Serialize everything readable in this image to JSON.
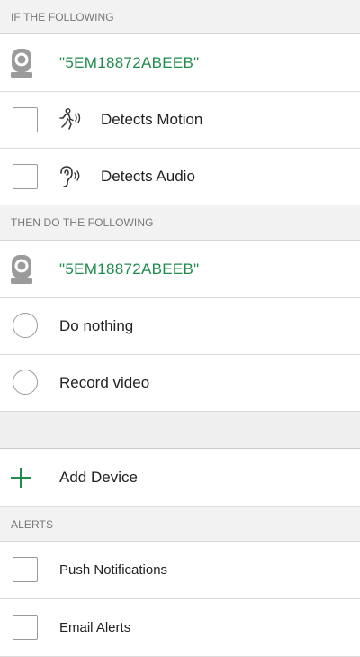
{
  "if_section": {
    "header": "IF THE FOLLOWING",
    "device_name": "\"5EM18872ABEEB\"",
    "triggers": [
      {
        "label": "Detects Motion",
        "icon": "motion-icon",
        "checked": false
      },
      {
        "label": "Detects Audio",
        "icon": "audio-icon",
        "checked": false
      }
    ]
  },
  "then_section": {
    "header": "THEN DO THE FOLLOWING",
    "device_name": "\"5EM18872ABEEB\"",
    "actions": [
      {
        "label": "Do nothing",
        "selected": false
      },
      {
        "label": "Record video",
        "selected": false
      }
    ]
  },
  "add_device": {
    "label": "Add Device",
    "icon": "plus-icon"
  },
  "alerts": {
    "header": "ALERTS",
    "items": [
      {
        "label": "Push Notifications",
        "checked": false
      },
      {
        "label": "Email Alerts",
        "checked": false
      }
    ]
  },
  "colors": {
    "accent_green": "#1f8b4c",
    "header_bg": "#f2f2f2",
    "row_bg": "#ffffff"
  }
}
